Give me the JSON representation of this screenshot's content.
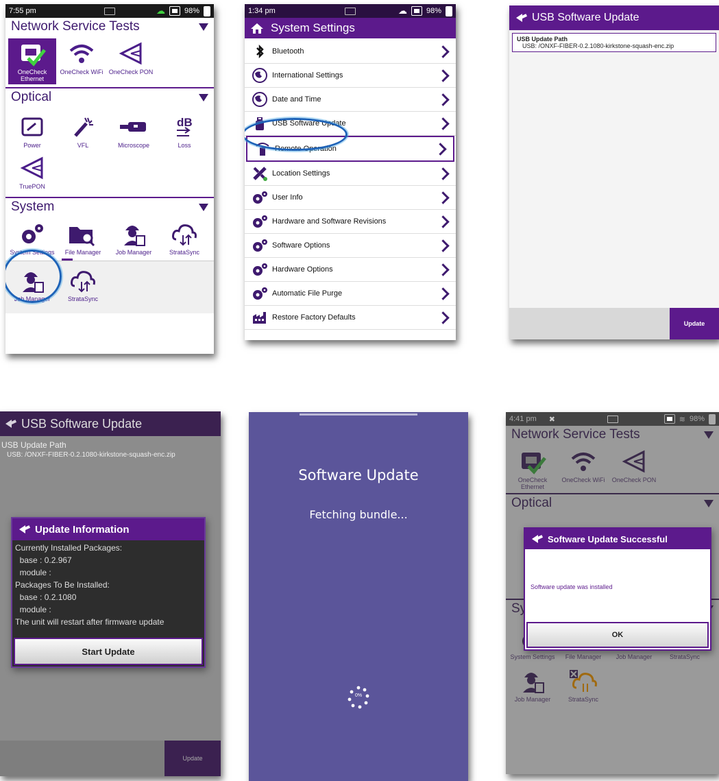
{
  "home_before": {
    "status_time": "7:55 pm",
    "status_battery": "98%",
    "sections": [
      {
        "title": "Network Service Tests",
        "tiles": [
          "OneCheck Ethernet",
          "OneCheck WiFi",
          "OneCheck PON"
        ]
      },
      {
        "title": "Optical",
        "tiles": [
          "Power",
          "VFL",
          "Microscope",
          "Loss",
          "TruePON"
        ]
      },
      {
        "title": "System",
        "tiles": [
          "System Settings",
          "File Manager",
          "Job Manager",
          "StrataSync"
        ]
      }
    ],
    "bottom_tiles": [
      "Job Manager",
      "StrataSync"
    ]
  },
  "settings": {
    "status_time": "1:34 pm",
    "status_battery": "98%",
    "title": "System Settings",
    "items": [
      {
        "label": "Bluetooth",
        "icon": "bluetooth-icon"
      },
      {
        "label": "International Settings",
        "icon": "globe-icon"
      },
      {
        "label": "Date and Time",
        "icon": "globe-icon"
      },
      {
        "label": "USB Software Update",
        "icon": "usb-icon"
      },
      {
        "label": "Remote Operation",
        "icon": "remote-icon"
      },
      {
        "label": "Location Settings",
        "icon": "satellite-icon"
      },
      {
        "label": "User Info",
        "icon": "gears-icon"
      },
      {
        "label": "Hardware and Software Revisions",
        "icon": "gears-icon"
      },
      {
        "label": "Software Options",
        "icon": "gears-icon"
      },
      {
        "label": "Hardware Options",
        "icon": "gears-icon"
      },
      {
        "label": "Automatic File Purge",
        "icon": "gears-icon"
      },
      {
        "label": "Restore Factory Defaults",
        "icon": "factory-icon"
      }
    ]
  },
  "usb_update": {
    "title": "USB Software Update",
    "path_label": "USB Update Path",
    "path_value": "USB: /ONXF-FIBER-0.2.1080-kirkstone-squash-enc.zip",
    "update_button": "Update"
  },
  "update_info": {
    "bg_title": "USB Software Update",
    "bg_path_label": "USB Update Path",
    "bg_path_value": "USB: /ONXF-FIBER-0.2.1080-kirkstone-squash-enc.zip",
    "bg_update_button": "Update",
    "dialog_title": "Update Information",
    "lines": [
      "Currently Installed Packages:",
      "  base : 0.2.967",
      "  module :",
      "Packages To Be Installed:",
      "  base : 0.2.1080",
      "  module :",
      "The unit will restart after firmware update"
    ],
    "start_button": "Start Update"
  },
  "progress_screen": {
    "title": "Software Update",
    "status": "Fetching bundle...",
    "spinner_text": "0%",
    "bg": "#5b559a"
  },
  "home_after": {
    "status_time": "4:41 pm",
    "status_battery": "98%",
    "sections": [
      {
        "title": "Network Service Tests",
        "tiles": [
          "OneCheck Ethernet",
          "OneCheck WiFi",
          "OneCheck PON"
        ]
      },
      {
        "title": "Optical"
      },
      {
        "title": "System",
        "tiles": [
          "System Settings",
          "File Manager",
          "Job Manager",
          "StrataSync"
        ]
      }
    ],
    "bottom_tiles": [
      "Job Manager",
      "StrataSync"
    ],
    "dialog_title": "Software Update Successful",
    "dialog_message": "Software update was installed",
    "ok_button": "OK"
  },
  "colors": {
    "purple": "#5c1a8c",
    "ring": "#1e63b8"
  }
}
